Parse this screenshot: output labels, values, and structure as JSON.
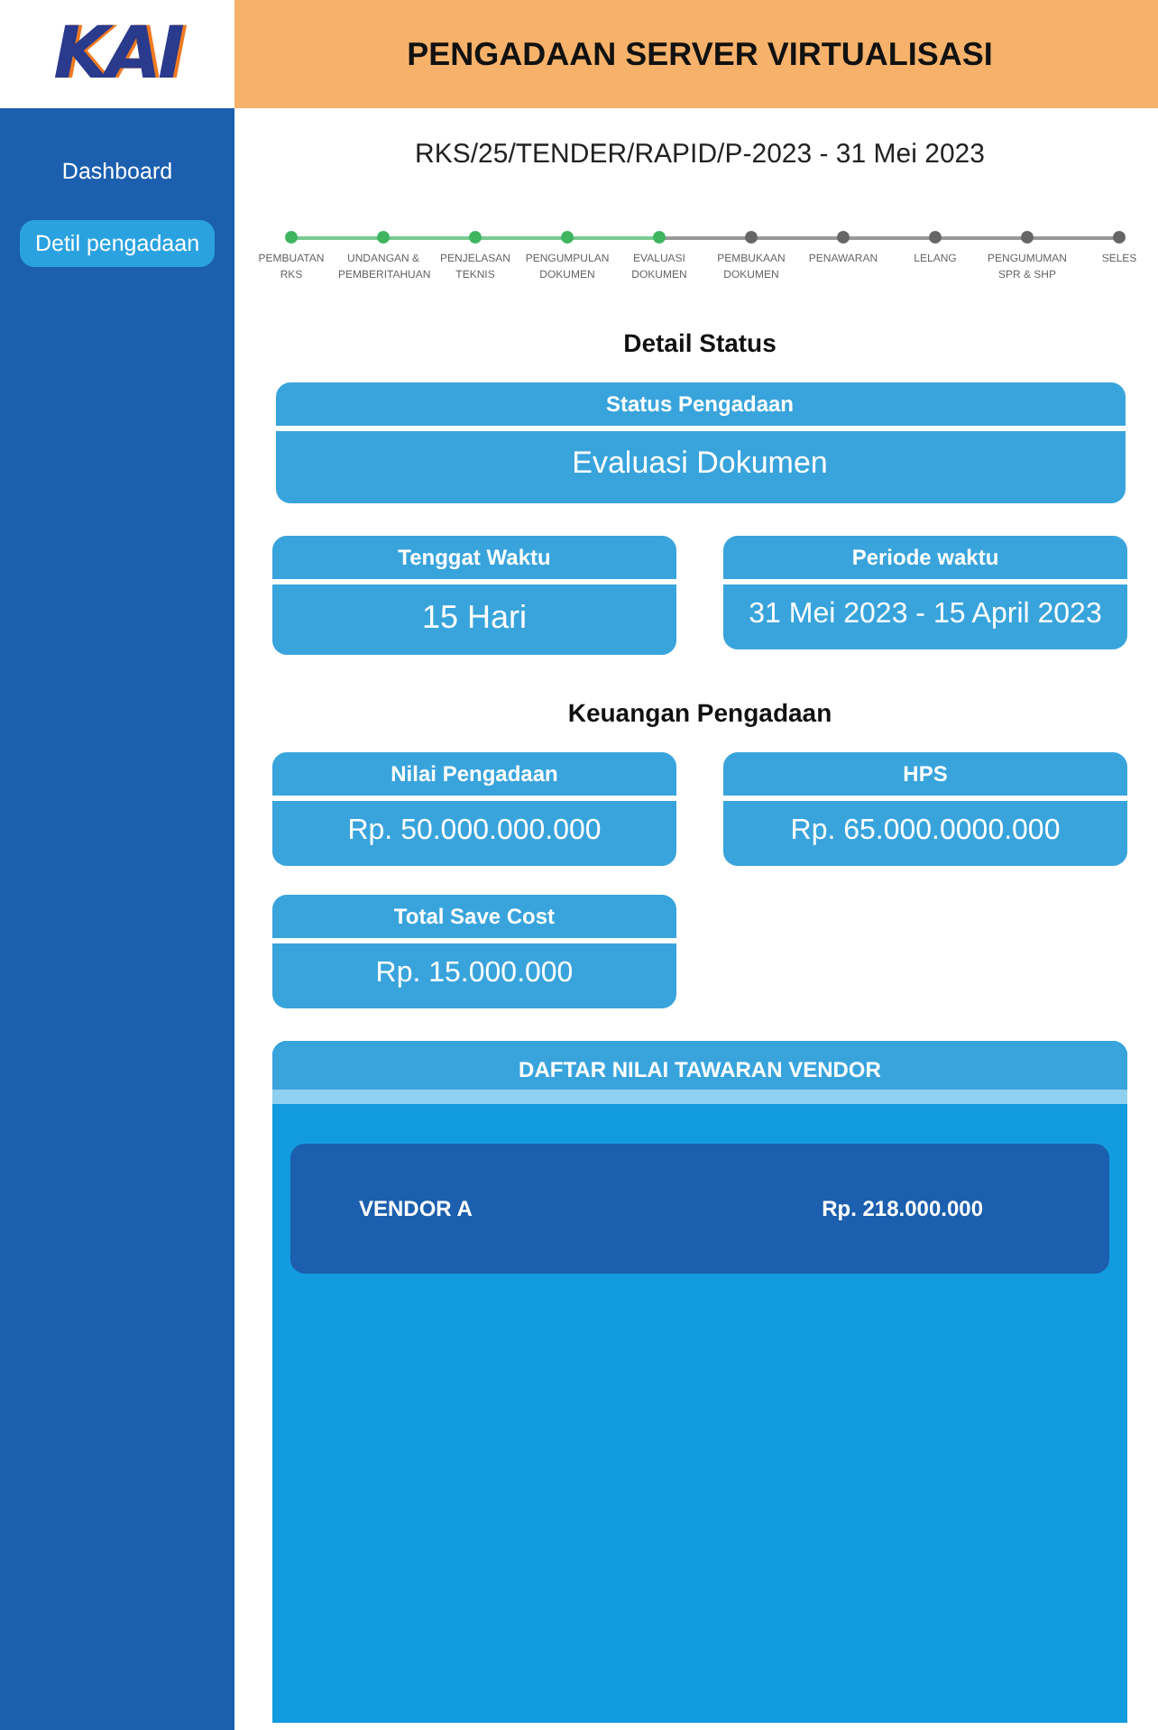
{
  "logo": "KAI",
  "sidebar": {
    "items": [
      {
        "label": "Dashboard",
        "selected": false
      },
      {
        "label": "Detil pengadaan",
        "selected": true
      }
    ]
  },
  "header": {
    "title": "PENGADAAN SERVER VIRTUALISASI"
  },
  "reference": "RKS/25/TENDER/RAPID/P-2023 - 31 Mei 2023",
  "stepper": [
    {
      "label": "PEMBUATAN RKS",
      "done": true
    },
    {
      "label": "UNDANGAN & PEMBERITAHUAN",
      "done": true
    },
    {
      "label": "PENJELASAN TEKNIS",
      "done": true
    },
    {
      "label": "PENGUMPULAN DOKUMEN",
      "done": true
    },
    {
      "label": "EVALUASI DOKUMEN",
      "done": true
    },
    {
      "label": "PEMBUKAAN DOKUMEN",
      "done": false
    },
    {
      "label": "PENAWARAN",
      "done": false
    },
    {
      "label": "LELANG",
      "done": false
    },
    {
      "label": "PENGUMUMAN SPR & SHP",
      "done": false
    },
    {
      "label": "SELES",
      "done": false
    }
  ],
  "detail_status": {
    "title": "Detail Status",
    "status": {
      "label": "Status Pengadaan",
      "value": "Evaluasi Dokumen"
    },
    "deadline": {
      "label": "Tenggat Waktu",
      "value": "15 Hari"
    },
    "period": {
      "label": "Periode waktu",
      "value": "31 Mei 2023 - 15 April 2023"
    }
  },
  "finance": {
    "title": "Keuangan Pengadaan",
    "cards": [
      {
        "label": "Nilai Pengadaan",
        "value": "Rp. 50.000.000.000"
      },
      {
        "label": "HPS",
        "value": "Rp. 65.000.0000.000"
      },
      {
        "label": "Total Save Cost",
        "value": "Rp. 15.000.000"
      }
    ]
  },
  "vendor_list": {
    "title": "DAFTAR NILAI TAWARAN VENDOR",
    "rows": [
      {
        "vendor": "VENDOR A",
        "amount": "Rp. 218.000.000"
      }
    ]
  }
}
